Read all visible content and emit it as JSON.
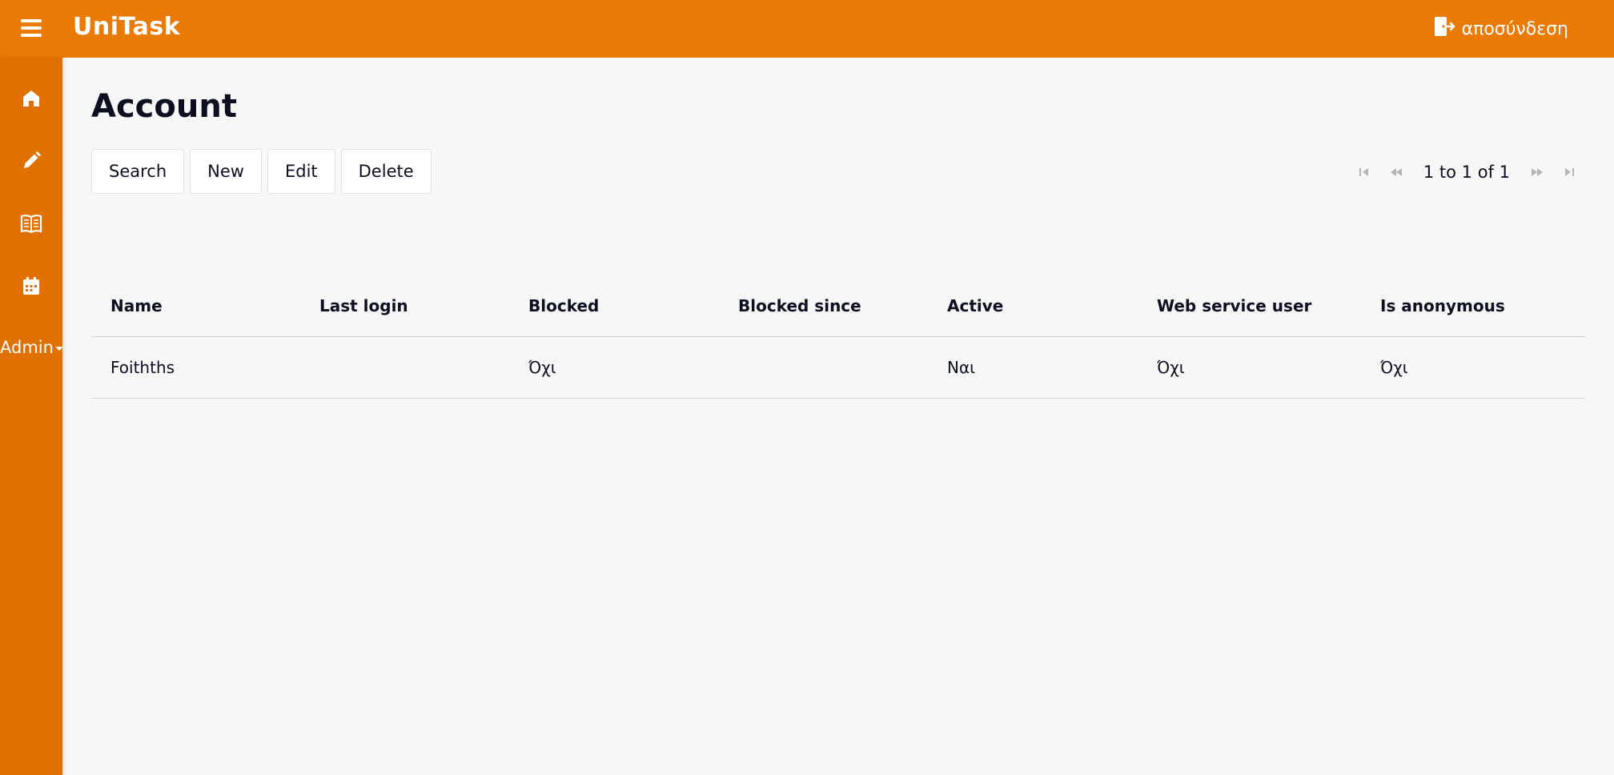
{
  "app": {
    "title": "UniTask",
    "logout_label": "αποσύνδεση"
  },
  "icons": {
    "menu": "hamburger-menu-icon",
    "logout": "door-exit-icon",
    "home": "home-icon",
    "edit": "pencil-icon",
    "book": "open-book-icon",
    "calendar": "calendar-icon"
  },
  "colors": {
    "topbar": "#e97a03",
    "sidebar": "#e07000",
    "background": "#f7f7f7"
  },
  "sidebar": {
    "admin_label": "Admin"
  },
  "page": {
    "title": "Account"
  },
  "toolbar": {
    "search_label": "Search",
    "new_label": "New",
    "edit_label": "Edit",
    "delete_label": "Delete"
  },
  "pager": {
    "text": "1 to 1 of 1"
  },
  "table": {
    "columns": [
      "Name",
      "Last login",
      "Blocked",
      "Blocked since",
      "Active",
      "Web service user",
      "Is anonymous"
    ],
    "rows": [
      [
        "Foithths",
        "",
        "Όχι",
        "",
        "Ναι",
        "Όχι",
        "Όχι"
      ]
    ]
  }
}
